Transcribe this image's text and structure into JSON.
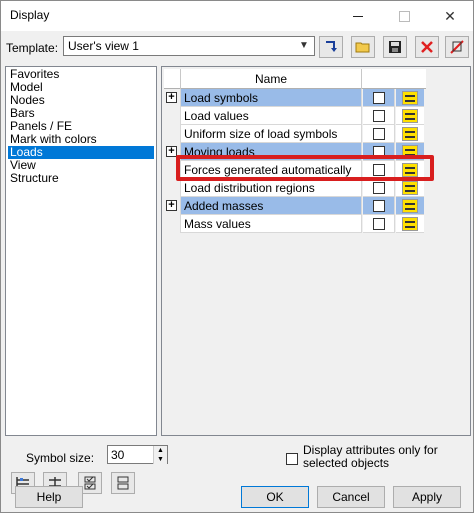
{
  "window": {
    "title": "Display"
  },
  "template": {
    "label": "Template:",
    "value": "User's view 1"
  },
  "toolbar": {
    "icons": [
      "apply-template-icon",
      "open-folder-icon",
      "save-icon",
      "delete-icon",
      "clear-icon"
    ]
  },
  "tree": {
    "items": [
      "Favorites",
      "Model",
      "Nodes",
      "Bars",
      "Panels / FE",
      "Mark with colors",
      "Loads",
      "View",
      "Structure"
    ],
    "selected": "Loads"
  },
  "grid": {
    "header": "Name",
    "rows": [
      {
        "label": "Load symbols",
        "group": true
      },
      {
        "label": "Load values",
        "group": false
      },
      {
        "label": "Uniform size of load symbols",
        "group": false
      },
      {
        "label": "Moving loads",
        "group": true
      },
      {
        "label": "Forces generated automatically",
        "group": false
      },
      {
        "label": "Load distribution regions",
        "group": false
      },
      {
        "label": "Added masses",
        "group": true
      },
      {
        "label": "Mass values",
        "group": false
      }
    ]
  },
  "symbol_size": {
    "label": "Symbol size:",
    "value": "30"
  },
  "display_attrs": {
    "label": "Display attributes only for selected objects"
  },
  "buttons": {
    "help": "Help",
    "ok": "OK",
    "cancel": "Cancel",
    "apply": "Apply"
  },
  "colors": {
    "selection": "#0078d7",
    "group_row": "#99bbe8",
    "highlight": "#d81e1e",
    "icon_yellow": "#ffe000"
  }
}
